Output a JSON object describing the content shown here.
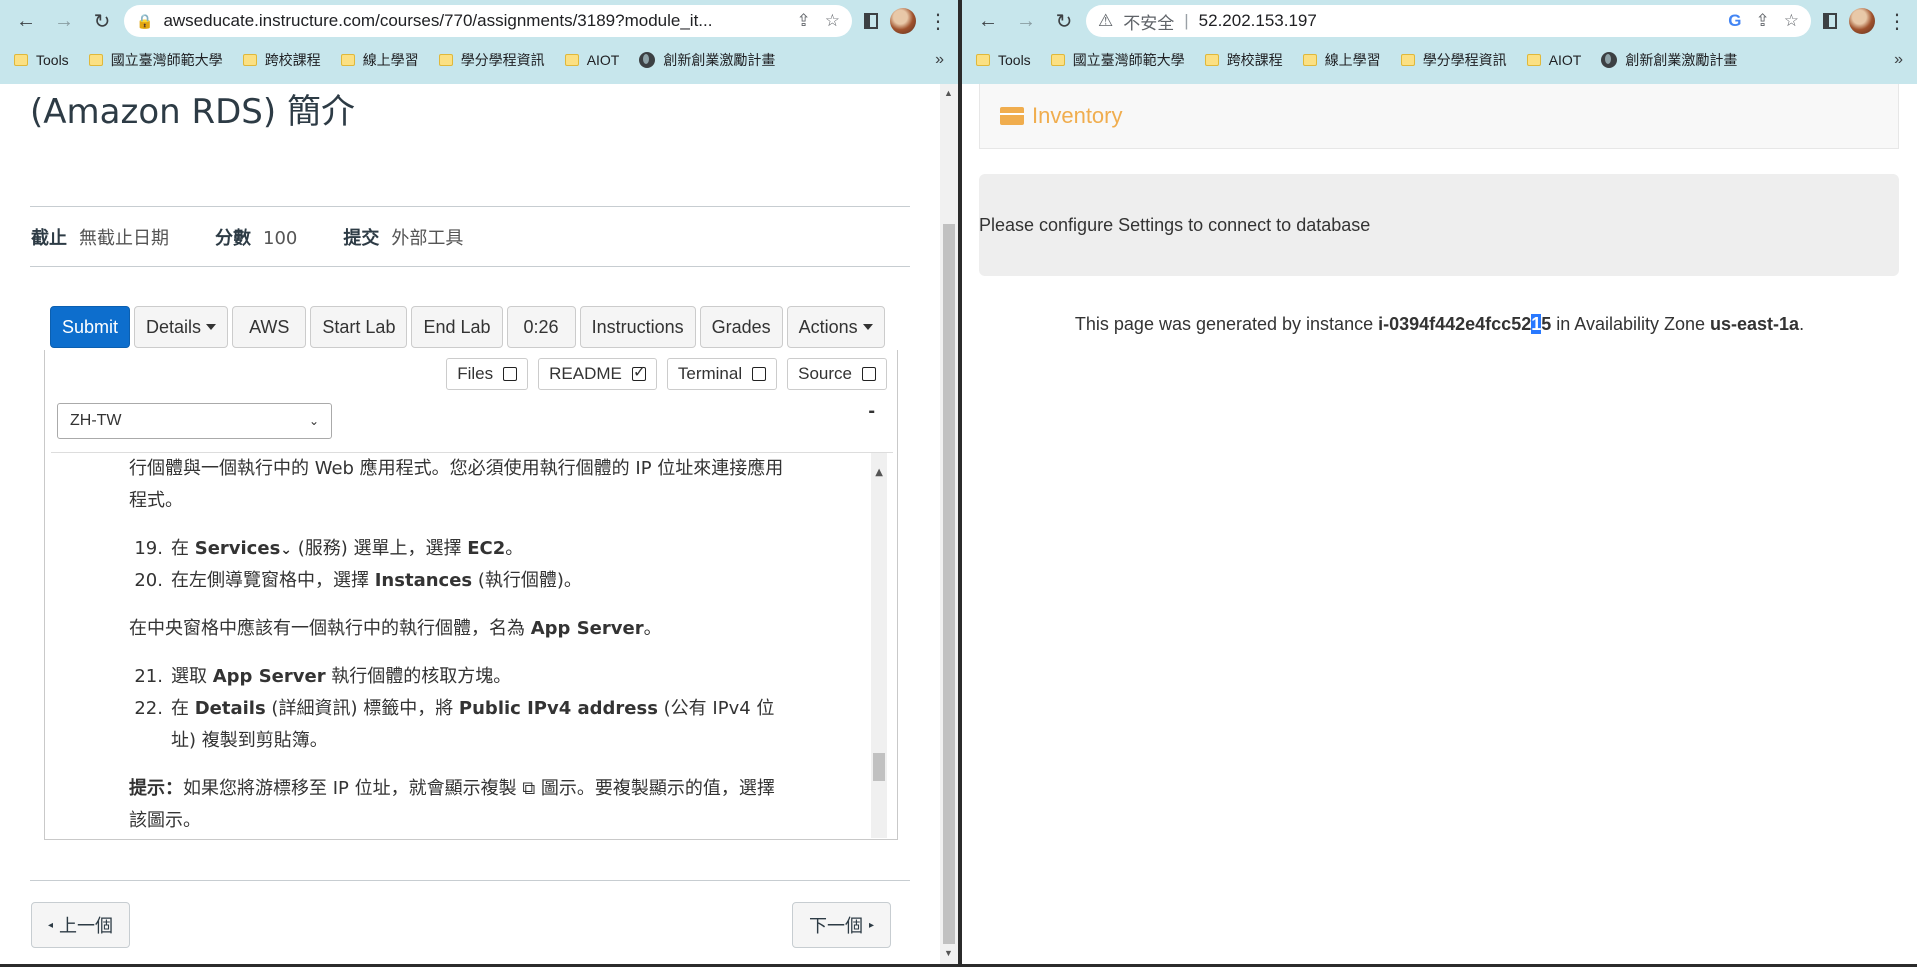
{
  "left": {
    "browser": {
      "url": "awseducate.instructure.com/courses/770/assignments/3189?module_it...",
      "bookmarks": [
        "Tools",
        "國立臺灣師範大學",
        "跨校課程",
        "線上學習",
        "學分學程資訊",
        "AIOT",
        "創新創業激勵計畫"
      ]
    },
    "page_title": "(Amazon RDS) 簡介",
    "meta": {
      "due_label": "截止",
      "due_value": "無截止日期",
      "points_label": "分數",
      "points_value": "100",
      "submit_label": "提交",
      "submit_value": "外部工具"
    },
    "toolbar": {
      "submit": "Submit",
      "details": "Details",
      "aws": "AWS",
      "start_lab": "Start Lab",
      "end_lab": "End Lab",
      "timer": "0:26",
      "instructions": "Instructions",
      "grades": "Grades",
      "actions": "Actions"
    },
    "panel": {
      "files": "Files",
      "readme": "README",
      "terminal": "Terminal",
      "source": "Source",
      "language": "ZH-TW",
      "collapse": "-"
    },
    "readme": {
      "p1": "行個體與一個執行中的 Web 應用程式。您必須使用執行個體的 IP 位址來連接應用程式。",
      "s19_num": "19.",
      "s19_a": "在 ",
      "s19_b": "Services",
      "s19_c": " (服務) 選單上，選擇 ",
      "s19_d": "EC2",
      "s19_e": "。",
      "s20_num": "20.",
      "s20_a": "在左側導覽窗格中，選擇 ",
      "s20_b": "Instances",
      "s20_c": " (執行個體)。",
      "p2_a": "在中央窗格中應該有一個執行中的執行個體，名為 ",
      "p2_b": "App Server",
      "p2_c": "。",
      "s21_num": "21.",
      "s21_a": "選取 ",
      "s21_b": "App Server",
      "s21_c": " 執行個體的核取方塊。",
      "s22_num": "22.",
      "s22_a": "在 ",
      "s22_b": "Details",
      "s22_c": " (詳細資訊) 標籤中，將 ",
      "s22_d": "Public IPv4 address",
      "s22_e": " (公有 IPv4 位址) 複製到剪貼簿。",
      "tip_a": "提示：",
      "tip_b": "如果您將游標移至 IP 位址，就會顯示複製 ",
      "tip_c": " 圖示。要複製顯示的值，選擇該圖示。"
    },
    "pager": {
      "prev": "上一個",
      "next": "下一個"
    }
  },
  "right": {
    "browser": {
      "security": "不安全",
      "url": "52.202.153.197",
      "bookmarks": [
        "Tools",
        "國立臺灣師範大學",
        "跨校課程",
        "線上學習",
        "學分學程資訊",
        "AIOT",
        "創新創業激勵計畫"
      ]
    },
    "brand": "Inventory",
    "alert": "Please configure Settings to connect to database",
    "footer": {
      "a": "This page was generated by instance ",
      "id_pre": "i-0394f442e4fcc52",
      "id_hl": "1",
      "id_post": "5",
      "b": " in Availability Zone ",
      "zone": "us-east-1a",
      "c": "."
    }
  },
  "colors": {
    "chrome": "#c7e6ec",
    "primary": "#0d6ecd",
    "brand": "#f0ad4e",
    "highlight": "#2979ff"
  }
}
